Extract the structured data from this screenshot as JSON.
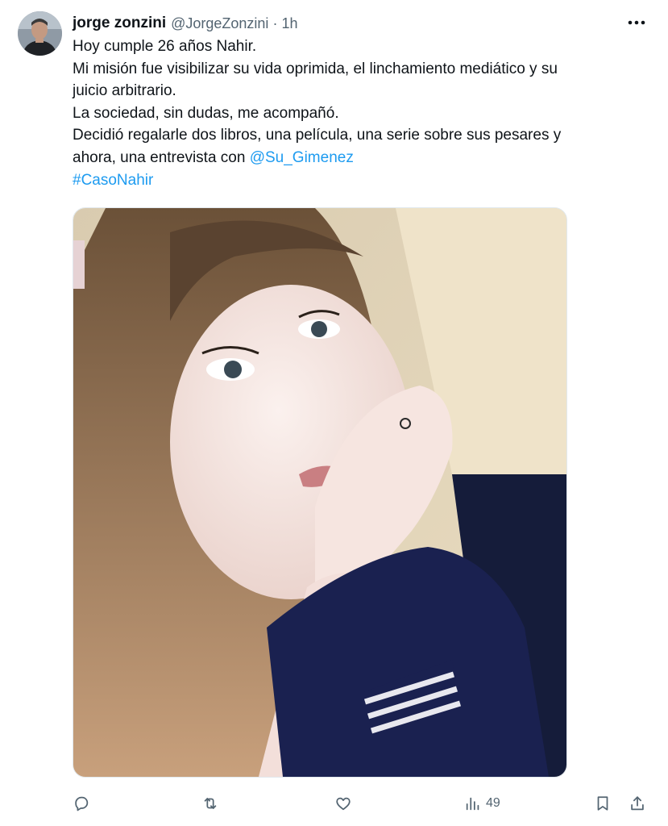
{
  "author": {
    "name": "jorge zonzini",
    "handle": "@JorgeZonzini",
    "separator": "·",
    "time": "1h",
    "avatar_icon": "user-avatar"
  },
  "tweet": {
    "lines": [
      "Hoy cumple 26 años Nahir.",
      "Mi misión fue visibilizar su vida oprimida, el linchamiento mediático y su",
      "juicio arbitrario.",
      "La sociedad, sin dudas, me acompañó.",
      "Decidió regalarle dos libros, una película, una serie sobre sus pesares y"
    ],
    "last_line_prefix": "ahora, una entrevista con ",
    "mention": "@Su_Gimenez",
    "hashtag": "#CasoNahir"
  },
  "media": {
    "description_icon": "photo"
  },
  "actions": {
    "reply_icon": "reply-icon",
    "retweet_icon": "retweet-icon",
    "like_icon": "heart-icon",
    "views_icon": "views-icon",
    "views_count": "49",
    "bookmark_icon": "bookmark-icon",
    "share_icon": "share-icon"
  },
  "colors": {
    "link": "#1d9bf0",
    "secondary": "#536471",
    "text": "#0f1419"
  }
}
